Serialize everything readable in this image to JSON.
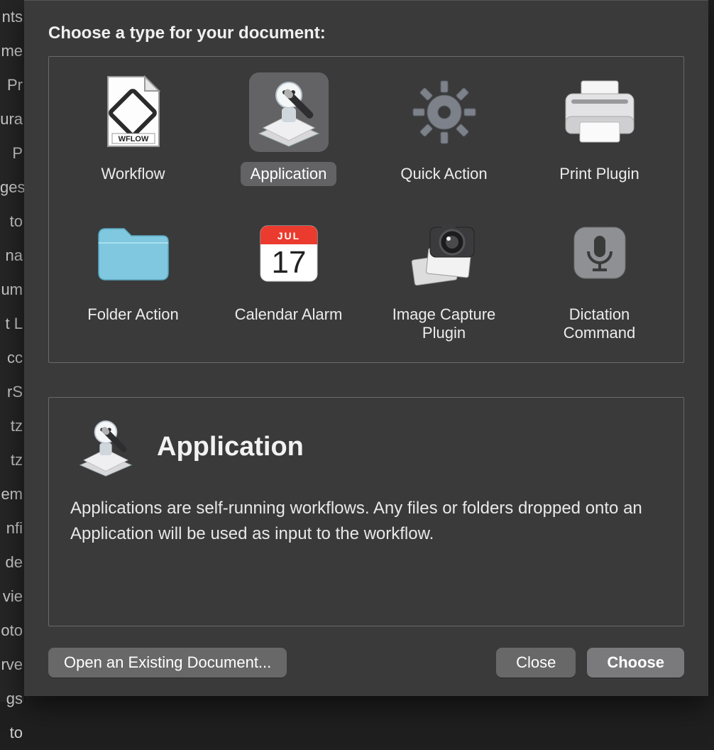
{
  "dialog": {
    "prompt": "Choose a type for your document:",
    "types": [
      {
        "id": "workflow",
        "label": "Workflow"
      },
      {
        "id": "application",
        "label": "Application",
        "selected": true
      },
      {
        "id": "quick-action",
        "label": "Quick Action"
      },
      {
        "id": "print-plugin",
        "label": "Print Plugin"
      },
      {
        "id": "folder-action",
        "label": "Folder Action"
      },
      {
        "id": "calendar-alarm",
        "label": "Calendar Alarm",
        "calendar_month": "JUL",
        "calendar_day": "17"
      },
      {
        "id": "image-capture-plugin",
        "label": "Image Capture Plugin"
      },
      {
        "id": "dictation-command",
        "label": "Dictation Command"
      }
    ],
    "description": {
      "title": "Application",
      "body": "Applications are self-running workflows. Any files or folders dropped onto an Application will be used as input to the workflow."
    },
    "buttons": {
      "open_existing": "Open an Existing Document...",
      "close": "Close",
      "choose": "Choose"
    }
  },
  "background_list_fragments": [
    "nts",
    "me",
    "Pr",
    "ura",
    "P",
    "ges",
    "to",
    "na",
    "um",
    "t L",
    "cc",
    "rS",
    "tz",
    "tz",
    "",
    "em",
    "nfi",
    "de",
    "vie",
    "oto",
    "rve",
    "gs",
    "to"
  ],
  "wflow_badge": "WFLOW"
}
